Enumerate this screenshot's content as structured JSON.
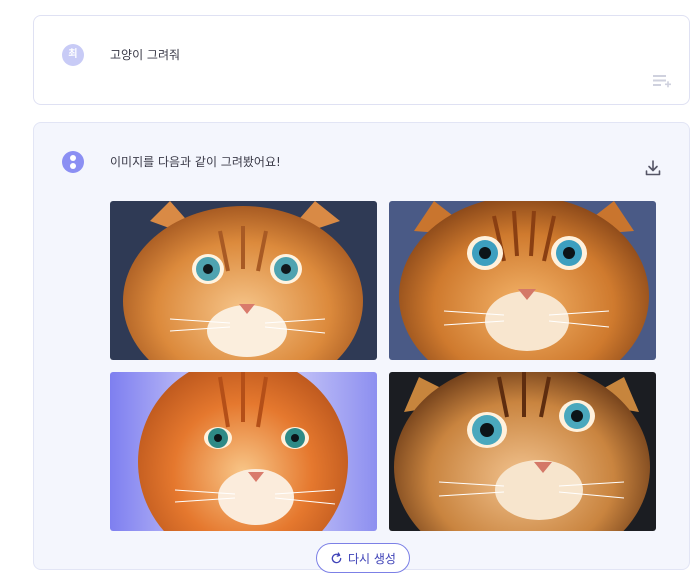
{
  "user_message": {
    "avatar_initial": "최",
    "text": "고양이 그려줘",
    "avatar_color": "#c8cbf6"
  },
  "assistant_message": {
    "text": "이미지를 다음과 같이 그려봤어요!",
    "avatar_color": "#8b8ff3",
    "images": [
      {
        "icon": "orange-tabby-cat-image",
        "background": "#2f3a55"
      },
      {
        "icon": "orange-tabby-cat-image",
        "background": "#4a5a86"
      },
      {
        "icon": "fluffy-orange-cat-image",
        "background": "#8d8ff0"
      },
      {
        "icon": "orange-tabby-cat-image",
        "background": "#1b1d22"
      }
    ],
    "regenerate_label": "다시 생성"
  },
  "colors": {
    "accent": "#7c80e6",
    "card_border": "#dfe1f3",
    "assistant_background": "#f4f6fd"
  }
}
